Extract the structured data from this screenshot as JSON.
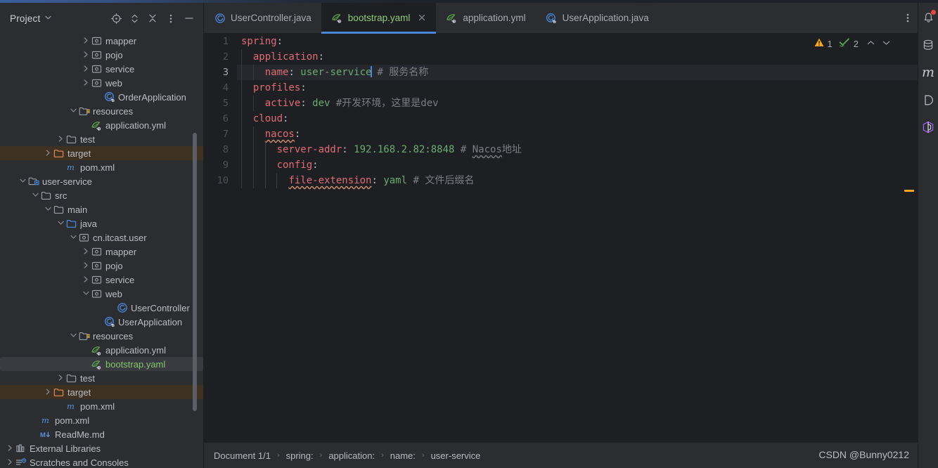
{
  "sidebar": {
    "title": "Project",
    "caret_icon": "chevron-down-icon",
    "tools": [
      {
        "name": "locate-icon",
        "label": "Select Opened File"
      },
      {
        "name": "expand-collapse-icon",
        "label": "Expand / Collapse"
      },
      {
        "name": "collapse-all-icon",
        "label": "Collapse All"
      },
      {
        "name": "more-options-icon",
        "label": "Options"
      },
      {
        "name": "hide-icon",
        "label": "Hide"
      }
    ],
    "tree": [
      {
        "label": "mapper",
        "indent": 6,
        "arrow": "right",
        "icon": "package-folder-icon"
      },
      {
        "label": "pojo",
        "indent": 6,
        "arrow": "right",
        "icon": "package-folder-icon"
      },
      {
        "label": "service",
        "indent": 6,
        "arrow": "right",
        "icon": "package-folder-icon"
      },
      {
        "label": "web",
        "indent": 6,
        "arrow": "right",
        "icon": "package-folder-icon"
      },
      {
        "label": "OrderApplication",
        "indent": 7,
        "arrow": "none",
        "icon": "spring-class-icon"
      },
      {
        "label": "resources",
        "indent": 5,
        "arrow": "down",
        "icon": "resources-folder-icon"
      },
      {
        "label": "application.yml",
        "indent": 6,
        "arrow": "none",
        "icon": "spring-yaml-icon"
      },
      {
        "label": "test",
        "indent": 4,
        "arrow": "right",
        "icon": "plain-folder-icon"
      },
      {
        "label": "target",
        "indent": 3,
        "arrow": "right",
        "icon": "target-folder-icon",
        "state": "excluded"
      },
      {
        "label": "pom.xml",
        "indent": 4,
        "arrow": "none",
        "icon": "maven-file-icon"
      },
      {
        "label": "user-service",
        "indent": 1,
        "arrow": "down",
        "icon": "module-folder-icon"
      },
      {
        "label": "src",
        "indent": 2,
        "arrow": "down",
        "icon": "plain-folder-icon"
      },
      {
        "label": "main",
        "indent": 3,
        "arrow": "down",
        "icon": "plain-folder-icon"
      },
      {
        "label": "java",
        "indent": 4,
        "arrow": "down",
        "icon": "sources-folder-icon"
      },
      {
        "label": "cn.itcast.user",
        "indent": 5,
        "arrow": "down",
        "icon": "package-folder-icon"
      },
      {
        "label": "mapper",
        "indent": 6,
        "arrow": "right",
        "icon": "package-folder-icon"
      },
      {
        "label": "pojo",
        "indent": 6,
        "arrow": "right",
        "icon": "package-folder-icon"
      },
      {
        "label": "service",
        "indent": 6,
        "arrow": "right",
        "icon": "package-folder-icon"
      },
      {
        "label": "web",
        "indent": 6,
        "arrow": "down",
        "icon": "package-folder-icon"
      },
      {
        "label": "UserController",
        "indent": 8,
        "arrow": "none",
        "icon": "java-class-icon"
      },
      {
        "label": "UserApplication",
        "indent": 7,
        "arrow": "none",
        "icon": "spring-class-icon"
      },
      {
        "label": "resources",
        "indent": 5,
        "arrow": "down",
        "icon": "resources-folder-icon"
      },
      {
        "label": "application.yml",
        "indent": 6,
        "arrow": "none",
        "icon": "spring-yaml-icon"
      },
      {
        "label": "bootstrap.yaml",
        "indent": 6,
        "arrow": "none",
        "icon": "spring-yaml-icon",
        "state": "selected"
      },
      {
        "label": "test",
        "indent": 4,
        "arrow": "right",
        "icon": "plain-folder-icon"
      },
      {
        "label": "target",
        "indent": 3,
        "arrow": "right",
        "icon": "target-folder-icon",
        "state": "excluded"
      },
      {
        "label": "pom.xml",
        "indent": 4,
        "arrow": "none",
        "icon": "maven-file-icon"
      },
      {
        "label": "pom.xml",
        "indent": 2,
        "arrow": "none",
        "icon": "maven-file-icon"
      },
      {
        "label": "ReadMe.md",
        "indent": 2,
        "arrow": "none",
        "icon": "markdown-file-icon"
      },
      {
        "label": "External Libraries",
        "indent": 0,
        "arrow": "right",
        "icon": "libraries-icon"
      },
      {
        "label": "Scratches and Consoles",
        "indent": 0,
        "arrow": "right",
        "icon": "scratches-icon"
      }
    ]
  },
  "tabs": {
    "items": [
      {
        "label": "UserController.java",
        "icon": "java-class-icon",
        "active": false,
        "closable": false
      },
      {
        "label": "bootstrap.yaml",
        "icon": "spring-yaml-icon",
        "active": true,
        "closable": true
      },
      {
        "label": "application.yml",
        "icon": "spring-yaml-icon",
        "active": false,
        "closable": false
      },
      {
        "label": "UserApplication.java",
        "icon": "spring-class-icon",
        "active": false,
        "closable": false
      }
    ],
    "more_label": "⋮"
  },
  "editor": {
    "current_line": 3,
    "lines": [
      {
        "n": "1",
        "guides": 0,
        "tokens": [
          {
            "t": "spring",
            "c": "key"
          },
          {
            "t": ":",
            "c": "plain"
          }
        ]
      },
      {
        "n": "2",
        "guides": 1,
        "tokens": [
          {
            "t": "  ",
            "c": "plain"
          },
          {
            "t": "application",
            "c": "key"
          },
          {
            "t": ":",
            "c": "plain"
          }
        ]
      },
      {
        "n": "3",
        "guides": 2,
        "tokens": [
          {
            "t": "    ",
            "c": "plain"
          },
          {
            "t": "name",
            "c": "key"
          },
          {
            "t": ": ",
            "c": "plain"
          },
          {
            "t": "user-service",
            "c": "val"
          },
          {
            "t": "CARET",
            "c": "caret"
          },
          {
            "t": " # 服务名称",
            "c": "cmt"
          }
        ]
      },
      {
        "n": "4",
        "guides": 1,
        "tokens": [
          {
            "t": "  ",
            "c": "plain"
          },
          {
            "t": "profiles",
            "c": "key"
          },
          {
            "t": ":",
            "c": "plain"
          }
        ]
      },
      {
        "n": "5",
        "guides": 2,
        "tokens": [
          {
            "t": "    ",
            "c": "plain"
          },
          {
            "t": "active",
            "c": "key"
          },
          {
            "t": ": ",
            "c": "plain"
          },
          {
            "t": "dev",
            "c": "val"
          },
          {
            "t": " #开发环境，这里是dev",
            "c": "cmt"
          }
        ]
      },
      {
        "n": "6",
        "guides": 1,
        "tokens": [
          {
            "t": "  ",
            "c": "plain"
          },
          {
            "t": "cloud",
            "c": "key"
          },
          {
            "t": ":",
            "c": "plain"
          }
        ]
      },
      {
        "n": "7",
        "guides": 2,
        "tokens": [
          {
            "t": "    ",
            "c": "plain"
          },
          {
            "t": "nacos",
            "c": "key wavy"
          },
          {
            "t": ":",
            "c": "plain"
          }
        ]
      },
      {
        "n": "8",
        "guides": 3,
        "tokens": [
          {
            "t": "      ",
            "c": "plain"
          },
          {
            "t": "server-addr",
            "c": "key"
          },
          {
            "t": ": ",
            "c": "plain"
          },
          {
            "t": "192.168.2.82:8848",
            "c": "val"
          },
          {
            "t": " # ",
            "c": "cmt"
          },
          {
            "t": "Nacos",
            "c": "cmt wavy-gray"
          },
          {
            "t": "地址",
            "c": "cmt"
          }
        ]
      },
      {
        "n": "9",
        "guides": 3,
        "tokens": [
          {
            "t": "      ",
            "c": "plain"
          },
          {
            "t": "config",
            "c": "key"
          },
          {
            "t": ":",
            "c": "plain"
          }
        ]
      },
      {
        "n": "10",
        "guides": 4,
        "tokens": [
          {
            "t": "        ",
            "c": "plain"
          },
          {
            "t": "file-extension",
            "c": "key wavy"
          },
          {
            "t": ": ",
            "c": "plain"
          },
          {
            "t": "yaml",
            "c": "val"
          },
          {
            "t": " # 文件后缀名",
            "c": "cmt"
          }
        ]
      }
    ],
    "inspections": {
      "warning_icon": "warning-triangle-icon",
      "warning_count": "1",
      "ok_icon": "inspection-check-icon",
      "ok_count": "2",
      "prev_icon": "chevron-up-icon",
      "next_icon": "chevron-down-icon"
    }
  },
  "statusbar": {
    "document": "Document 1/1",
    "breadcrumbs": [
      "spring:",
      "application:",
      "name:",
      "user-service"
    ],
    "watermark": "CSDN @Bunny0212"
  },
  "rightbar": {
    "items": [
      {
        "name": "notifications-icon",
        "badge": true
      },
      {
        "name": "database-icon",
        "badge": false
      },
      {
        "name": "maven-icon",
        "badge": false
      },
      {
        "name": "bean-validation-icon",
        "badge": false
      },
      {
        "name": "docker-icon",
        "badge": false
      }
    ]
  },
  "colors": {
    "accent": "#4a86d8",
    "yaml_green": "#6aab73",
    "key_red": "#e06c75",
    "warning": "#f5a623",
    "selected_bg": "#393b40",
    "excluded_bg": "#3e3121"
  }
}
